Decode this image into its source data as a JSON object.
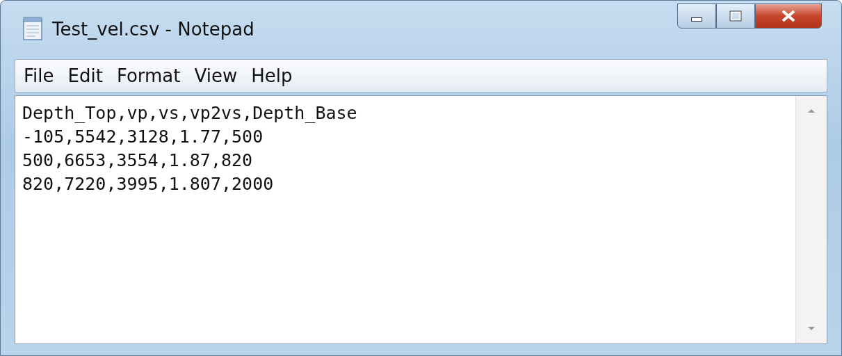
{
  "window": {
    "title": "Test_vel.csv - Notepad"
  },
  "menu": [
    {
      "label": "File"
    },
    {
      "label": "Edit"
    },
    {
      "label": "Format"
    },
    {
      "label": "View"
    },
    {
      "label": "Help"
    }
  ],
  "editor": {
    "lines": [
      "Depth_Top,vp,vs,vp2vs,Depth_Base",
      "-105,5542,3128,1.77,500",
      "500,6653,3554,1.87,820",
      "820,7220,3995,1.807,2000"
    ]
  }
}
